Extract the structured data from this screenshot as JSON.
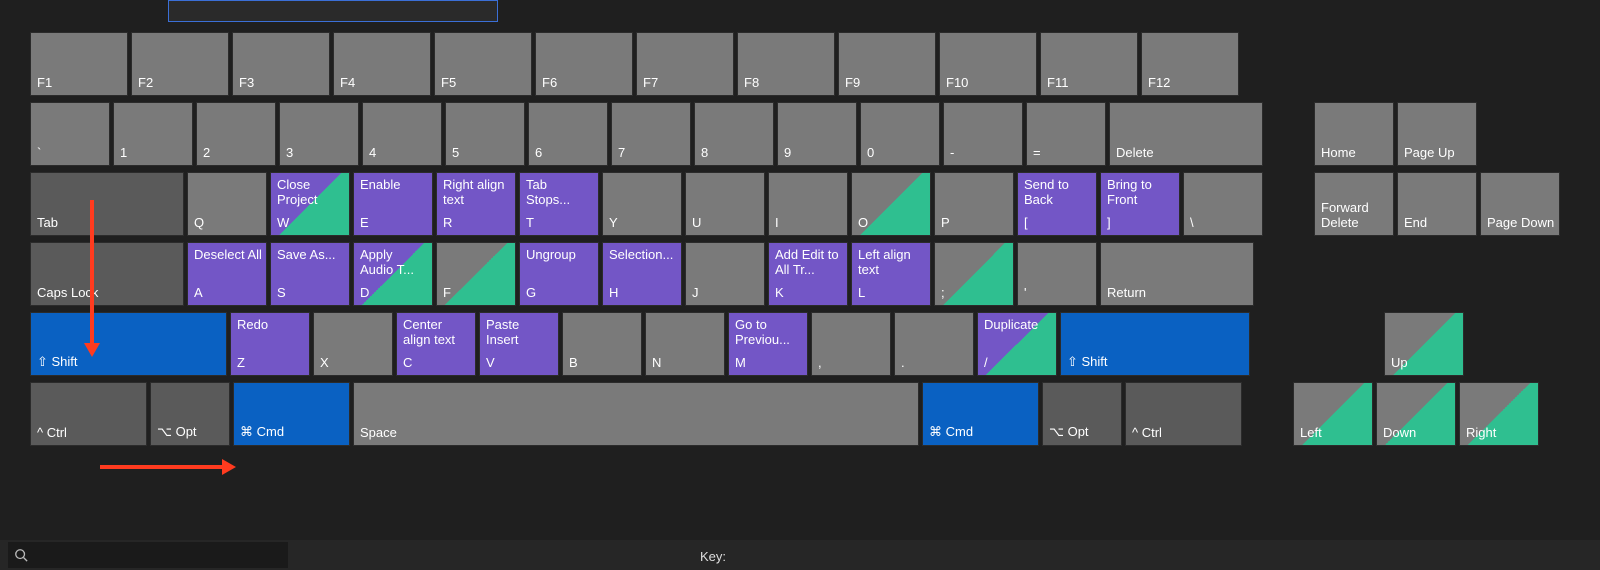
{
  "appSetPlaceholder": "",
  "footer": {
    "keyLabel": "Key:"
  },
  "fRow": [
    "F1",
    "F2",
    "F3",
    "F4",
    "F5",
    "F6",
    "F7",
    "F8",
    "F9",
    "F10",
    "F11",
    "F12"
  ],
  "numRow": {
    "keys": [
      "`",
      "1",
      "2",
      "3",
      "4",
      "5",
      "6",
      "7",
      "8",
      "9",
      "0",
      "-",
      "="
    ],
    "delete": "Delete",
    "nav": [
      "Home",
      "Page Up"
    ]
  },
  "tabRow": {
    "tab": "Tab",
    "keys": [
      {
        "k": "Q"
      },
      {
        "k": "W",
        "cmd": "Close Project",
        "style": "purple-green"
      },
      {
        "k": "E",
        "cmd": "Enable",
        "style": "purple"
      },
      {
        "k": "R",
        "cmd": "Right align text",
        "style": "purple"
      },
      {
        "k": "T",
        "cmd": "Tab Stops...",
        "style": "purple"
      },
      {
        "k": "Y"
      },
      {
        "k": "U"
      },
      {
        "k": "I"
      },
      {
        "k": "O",
        "style": "gray-green"
      },
      {
        "k": "P"
      },
      {
        "k": "[",
        "cmd": "Send to Back",
        "style": "purple"
      },
      {
        "k": "]",
        "cmd": "Bring to Front",
        "style": "purple"
      },
      {
        "k": "\\"
      }
    ],
    "nav": {
      "fd": "Forward Delete",
      "end": "End",
      "pd": "Page Down"
    }
  },
  "capsRow": {
    "caps": "Caps Lock",
    "keys": [
      {
        "k": "A",
        "cmd": "Deselect All",
        "style": "purple"
      },
      {
        "k": "S",
        "cmd": "Save As...",
        "style": "purple"
      },
      {
        "k": "D",
        "cmd": "Apply Audio T...",
        "style": "purple-green"
      },
      {
        "k": "F",
        "style": "gray-green"
      },
      {
        "k": "G",
        "cmd": "Ungroup",
        "style": "purple"
      },
      {
        "k": "H",
        "cmd": "Selection...",
        "style": "purple"
      },
      {
        "k": "J"
      },
      {
        "k": "K",
        "cmd": "Add Edit to All Tr...",
        "style": "purple"
      },
      {
        "k": "L",
        "cmd": "Left align text",
        "style": "purple"
      },
      {
        "k": ";",
        "style": "gray-green"
      },
      {
        "k": "'"
      }
    ],
    "return": "Return"
  },
  "shiftRow": {
    "shiftL": "⇧ Shift",
    "keys": [
      {
        "k": "Z",
        "cmd": "Redo",
        "style": "purple"
      },
      {
        "k": "X"
      },
      {
        "k": "C",
        "cmd": "Center align text",
        "style": "purple"
      },
      {
        "k": "V",
        "cmd": "Paste Insert",
        "style": "purple"
      },
      {
        "k": "B"
      },
      {
        "k": "N"
      },
      {
        "k": "M",
        "cmd": "Go to Previou...",
        "style": "purple"
      },
      {
        "k": ","
      },
      {
        "k": "."
      },
      {
        "k": "/",
        "cmd": "Duplicate",
        "style": "purple-green"
      }
    ],
    "shiftR": "⇧ Shift",
    "up": "Up"
  },
  "bottomRow": {
    "ctrlL": "^ Ctrl",
    "optL": "⌥ Opt",
    "cmdL": "⌘ Cmd",
    "space": "Space",
    "cmdR": "⌘ Cmd",
    "optR": "⌥ Opt",
    "ctrlR": "^ Ctrl",
    "arrows": [
      "Left",
      "Down",
      "Right"
    ]
  }
}
